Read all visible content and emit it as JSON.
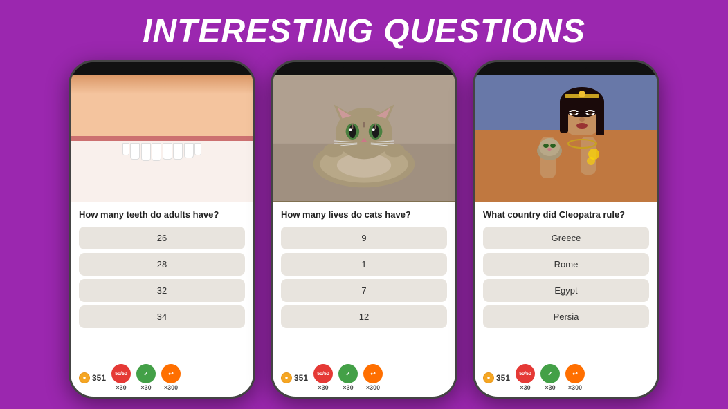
{
  "page": {
    "title": "INTERESTING QUESTIONS",
    "background_color": "#9b27af"
  },
  "phones": [
    {
      "id": "phone-1",
      "image_description": "smiling teeth closeup",
      "question": "How many teeth do adults have?",
      "answers": [
        "26",
        "28",
        "32",
        "34"
      ],
      "coins": "351",
      "badges": [
        {
          "type": "fifty",
          "label": "50/50",
          "count": "×30"
        },
        {
          "type": "check",
          "label": "✓",
          "count": "×30"
        },
        {
          "type": "skip",
          "label": "↩",
          "count": "×300"
        }
      ]
    },
    {
      "id": "phone-2",
      "image_description": "cat lying on back looking at camera",
      "question": "How many lives do cats have?",
      "answers": [
        "9",
        "1",
        "7",
        "12"
      ],
      "coins": "351",
      "badges": [
        {
          "type": "fifty",
          "label": "50/50",
          "count": "×30"
        },
        {
          "type": "check",
          "label": "✓",
          "count": "×30"
        },
        {
          "type": "skip",
          "label": "↩",
          "count": "×300"
        }
      ]
    },
    {
      "id": "phone-3",
      "image_description": "woman resembling Cleopatra holding cat",
      "question": "What country did Cleopatra rule?",
      "answers": [
        "Greece",
        "Rome",
        "Egypt",
        "Persia"
      ],
      "coins": "351",
      "badges": [
        {
          "type": "fifty",
          "label": "50/50",
          "count": "×30"
        },
        {
          "type": "check",
          "label": "✓",
          "count": "×30"
        },
        {
          "type": "skip",
          "label": "↩",
          "count": "×300"
        }
      ]
    }
  ]
}
